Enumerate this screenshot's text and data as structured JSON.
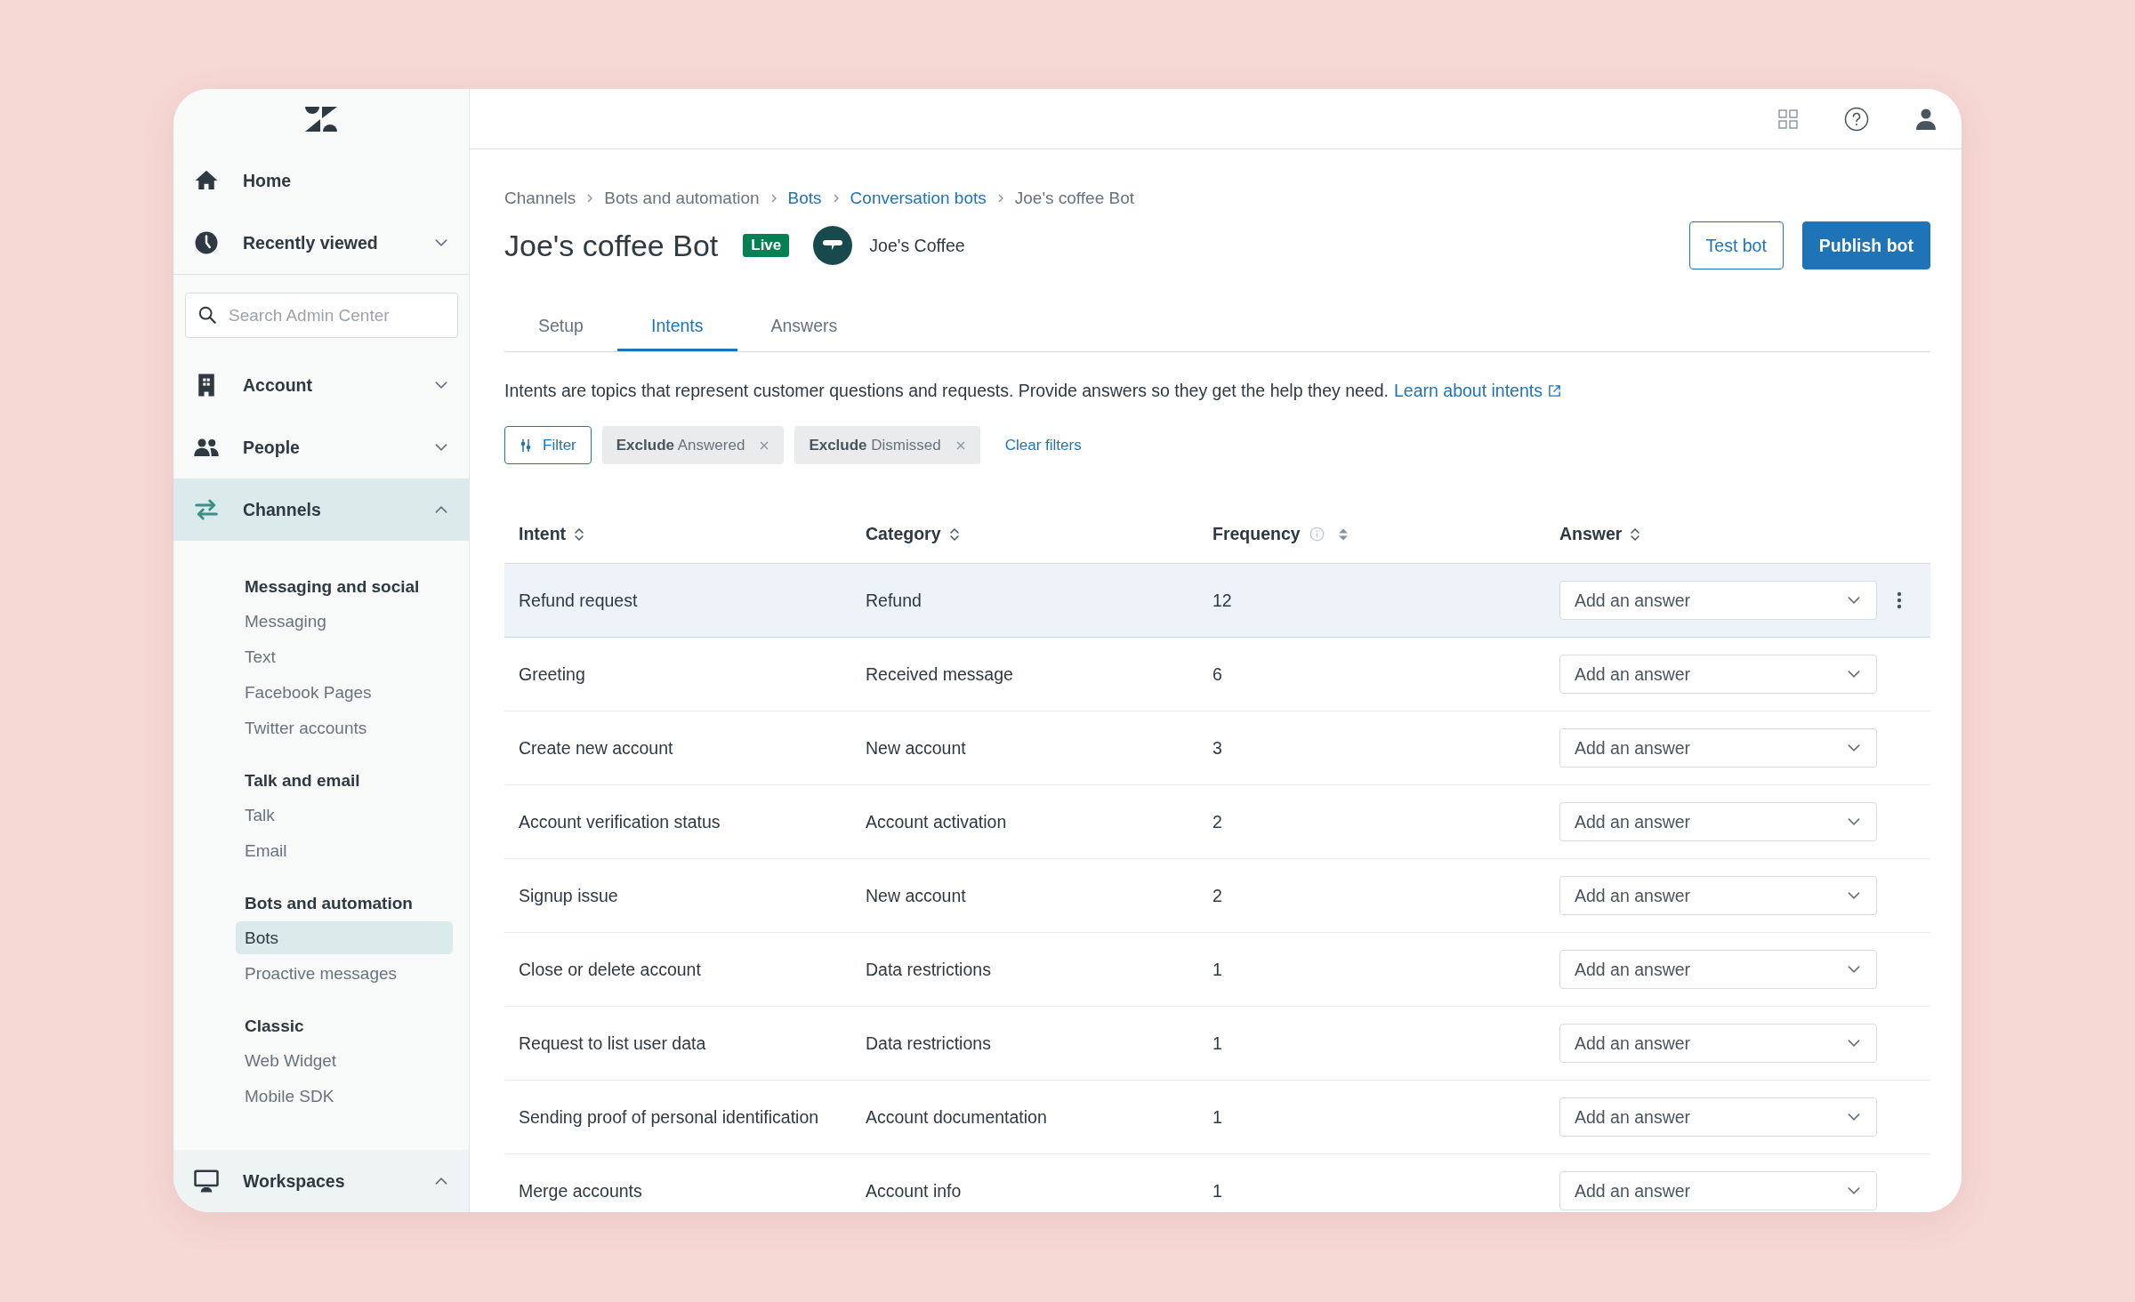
{
  "sidebar": {
    "top": [
      {
        "label": "Home",
        "kind": "link"
      },
      {
        "label": "Recently viewed",
        "kind": "menu",
        "expanded": false
      }
    ],
    "search": {
      "placeholder": "Search Admin Center"
    },
    "nav": [
      {
        "label": "Account",
        "kind": "menu",
        "expanded": false,
        "selected": false
      },
      {
        "label": "People",
        "kind": "menu",
        "expanded": false,
        "selected": false
      },
      {
        "label": "Channels",
        "kind": "menu",
        "expanded": true,
        "selected": true,
        "groups": [
          {
            "heading": "Messaging and social",
            "items": [
              {
                "label": "Messaging",
                "selected": false
              },
              {
                "label": "Text",
                "selected": false
              },
              {
                "label": "Facebook Pages",
                "selected": false
              },
              {
                "label": "Twitter accounts",
                "selected": false
              }
            ]
          },
          {
            "heading": "Talk and email",
            "items": [
              {
                "label": "Talk",
                "selected": false
              },
              {
                "label": "Email",
                "selected": false
              }
            ]
          },
          {
            "heading": "Bots and automation",
            "items": [
              {
                "label": "Bots",
                "selected": true
              },
              {
                "label": "Proactive messages",
                "selected": false
              }
            ]
          },
          {
            "heading": "Classic",
            "items": [
              {
                "label": "Web Widget",
                "selected": false
              },
              {
                "label": "Mobile SDK",
                "selected": false
              }
            ]
          }
        ]
      },
      {
        "label": "Workspaces",
        "kind": "pinned",
        "expanded": true,
        "selected": false
      }
    ]
  },
  "breadcrumb": [
    {
      "label": "Channels",
      "link": false
    },
    {
      "label": "Bots and automation",
      "link": false
    },
    {
      "label": "Bots",
      "link": true
    },
    {
      "label": "Conversation bots",
      "link": true
    },
    {
      "label": "Joe's coffee Bot",
      "link": false
    }
  ],
  "title": "Joe's coffee Bot",
  "status_badge": "Live",
  "brand": "Joe's Coffee",
  "buttons": [
    {
      "label": "Test bot",
      "kind": "secondary"
    },
    {
      "label": "Publish bot",
      "kind": "primary"
    }
  ],
  "tabs": [
    {
      "label": "Setup",
      "selected": false
    },
    {
      "label": "Intents",
      "selected": true
    },
    {
      "label": "Answers",
      "selected": false
    }
  ],
  "description": "Intents are topics that represent customer questions and requests. Provide answers so they get the help they need.",
  "description_link": "Learn about intents",
  "filter_button": "Filter",
  "filter_chips": [
    "**Exclude** Answered",
    "**Exclude** Dismissed"
  ],
  "clear_filters": "Clear filters",
  "table": {
    "columns": [
      {
        "label": "Intent",
        "info": false,
        "sorted": false
      },
      {
        "label": "Category",
        "info": false,
        "sorted": false
      },
      {
        "label": "Frequency",
        "info": true,
        "sorted": true
      },
      {
        "label": "Answer",
        "info": false,
        "sorted": false
      }
    ],
    "rows": [
      {
        "intent": "Refund request",
        "category": "Refund",
        "frequency": "12",
        "answer_placeholder": "Add an answer",
        "selected": true
      },
      {
        "intent": "Greeting",
        "category": "Received message",
        "frequency": "6",
        "answer_placeholder": "Add an answer",
        "selected": false
      },
      {
        "intent": "Create new account",
        "category": "New account",
        "frequency": "3",
        "answer_placeholder": "Add an answer",
        "selected": false
      },
      {
        "intent": "Account verification status",
        "category": "Account activation",
        "frequency": "2",
        "answer_placeholder": "Add an answer",
        "selected": false
      },
      {
        "intent": "Signup issue",
        "category": "New account",
        "frequency": "2",
        "answer_placeholder": "Add an answer",
        "selected": false
      },
      {
        "intent": "Close or delete account",
        "category": "Data restrictions",
        "frequency": "1",
        "answer_placeholder": "Add an answer",
        "selected": false
      },
      {
        "intent": "Request to list user data",
        "category": "Data restrictions",
        "frequency": "1",
        "answer_placeholder": "Add an answer",
        "selected": false
      },
      {
        "intent": "Sending proof of personal identification",
        "category": "Account documentation",
        "frequency": "1",
        "answer_placeholder": "Add an answer",
        "selected": false
      },
      {
        "intent": "Merge accounts",
        "category": "Account info",
        "frequency": "1",
        "answer_placeholder": "Add an answer",
        "selected": false
      }
    ]
  }
}
